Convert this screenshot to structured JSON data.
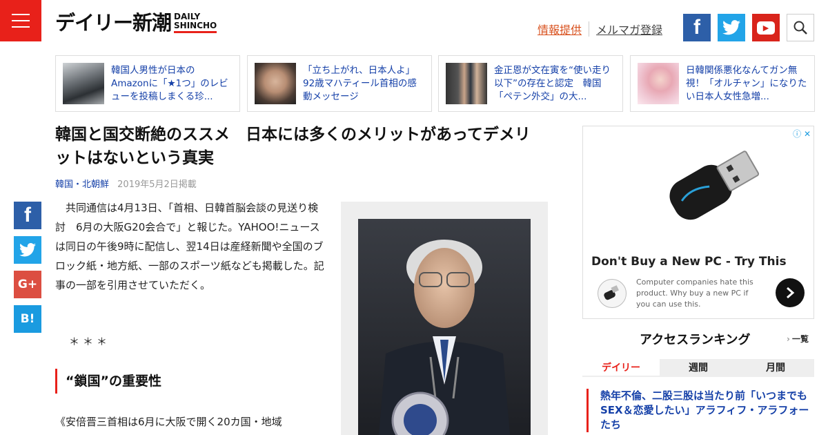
{
  "header": {
    "logo_jp": "デイリー新潮",
    "logo_en_line1": "DAILY",
    "logo_en_line2": "SHINCHO",
    "info_link": "情報提供",
    "mail_link": "メルマガ登録",
    "facebook_glyph": "f",
    "youtube_glyph": "▶"
  },
  "related": [
    {
      "text": "韓国人男性が日本のAmazonに「★1つ」のレビューを投稿しまくる珍..."
    },
    {
      "text": "「立ち上がれ、日本人よ」　92歳マハティール首相の感動メッセージ"
    },
    {
      "text": "金正恩が文在寅を“使い走り以下”の存在と認定　韓国「ペテン外交」の大..."
    },
    {
      "text": "日韓関係悪化なんてガン無視！「オルチャン」になりたい日本人女性急増..."
    }
  ],
  "article": {
    "title": "韓国と国交断絶のススメ　日本には多くのメリットがあってデメリットはないという真実",
    "category": "韓国・北朝鮮",
    "date": "2019年5月2日掲載",
    "body": "共同通信は4月13日、「首相、日韓首脳会談の見送り検討　6月の大阪G20会合で」と報じた。YAHOO!ニュースは同日の午後9時に配信し、翌14日は産経新聞や全国のブロック紙・地方紙、一部のスポーツ紙なども掲載した。記事の一部を引用させていただく。",
    "asterisks": "＊＊＊",
    "subhead": "“鎖国”の重要性",
    "quote_start": "《安倍晋三首相は6月に大阪で開く20カ国・地域"
  },
  "share": {
    "google": "G+",
    "hatena": "B!"
  },
  "ad": {
    "adchoices": "ⓘ ✕",
    "title": "Don't Buy a New PC - Try This",
    "desc": "Computer companies hate this product. Why buy a new PC if you can use this."
  },
  "ranking": {
    "title": "アクセスランキング",
    "all_link": "一覧",
    "tabs": [
      "デイリー",
      "週間",
      "月間"
    ],
    "first_item": "熱年不倫、二股三股は当たり前「いつまでもSEX＆恋愛したい」アラフィフ・アラフォーたち"
  }
}
